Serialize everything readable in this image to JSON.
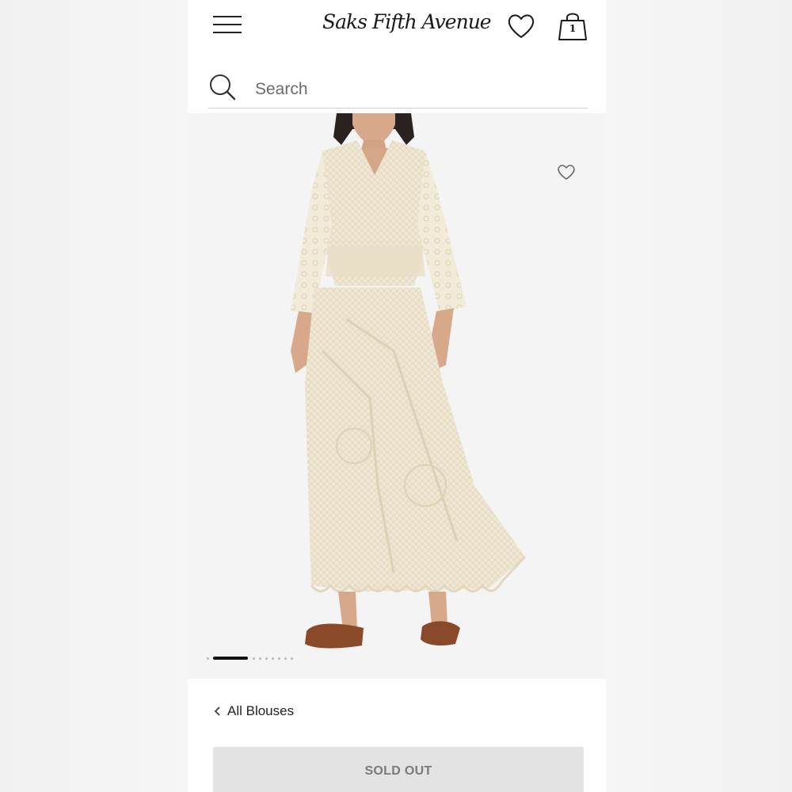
{
  "header": {
    "menu_icon": "hamburger-menu-icon",
    "logo_text": "Saks Fifth Avenue",
    "wishlist_icon": "heart-icon",
    "bag_icon": "shopping-bag-icon",
    "bag_count": "1"
  },
  "search": {
    "icon": "search-icon",
    "placeholder": "Search"
  },
  "product": {
    "image_description": "model-wearing-cream-lace-blouse-and-skirt",
    "favorite_icon": "heart-outline-icon",
    "carousel": {
      "total_slides": 9,
      "active_slide": 2
    }
  },
  "breadcrumb": {
    "icon": "chevron-left-icon",
    "label": "All Blouses"
  },
  "purchase": {
    "button_label": "SOLD OUT"
  },
  "colors": {
    "page_bg": "#f3f3f3",
    "product_bg": "#f4f4f4",
    "sold_out_bg": "#e3e3e3",
    "sold_out_text": "#7a7a7a",
    "active_dot": "#111111",
    "dress": "#f1ead9"
  }
}
